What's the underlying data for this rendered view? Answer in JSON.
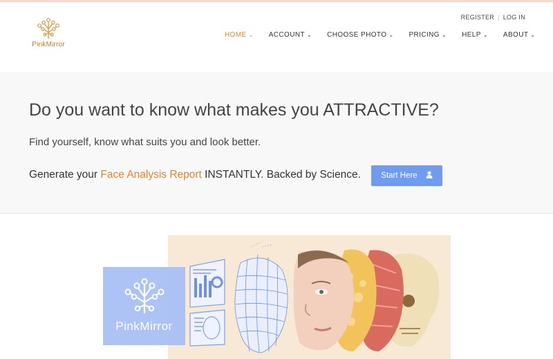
{
  "brand": {
    "name": "PinkMirror",
    "accent": "#e0862e",
    "button_color": "#6f9cf0"
  },
  "auth": {
    "register": "REGISTER",
    "separator": "|",
    "login": "LOG IN"
  },
  "nav": {
    "items": [
      {
        "label": "HOME",
        "icon": "chevron-down-icon"
      },
      {
        "label": "ACCOUNT",
        "icon": "chevron-down-icon"
      },
      {
        "label": "CHOOSE PHOTO",
        "icon": "chevron-down-icon"
      },
      {
        "label": "PRICING",
        "icon": "chevron-down-icon"
      },
      {
        "label": "HELP",
        "icon": "chevron-down-icon"
      },
      {
        "label": "ABOUT",
        "icon": "chevron-down-icon"
      }
    ],
    "active_index": 0
  },
  "hero": {
    "title": "Do you want to know what makes you ATTRACTIVE?",
    "subtitle": "Find yourself, know what suits you and look better.",
    "generate_prefix": "Generate your ",
    "generate_highlight": "Face Analysis Report",
    "generate_suffix": " INSTANTLY. Backed by Science.",
    "start_button": "Start Here",
    "start_icon": "user-icon"
  },
  "illustration": {
    "card_label": "PinkMirror",
    "icon": "tree-circuit-icon"
  }
}
